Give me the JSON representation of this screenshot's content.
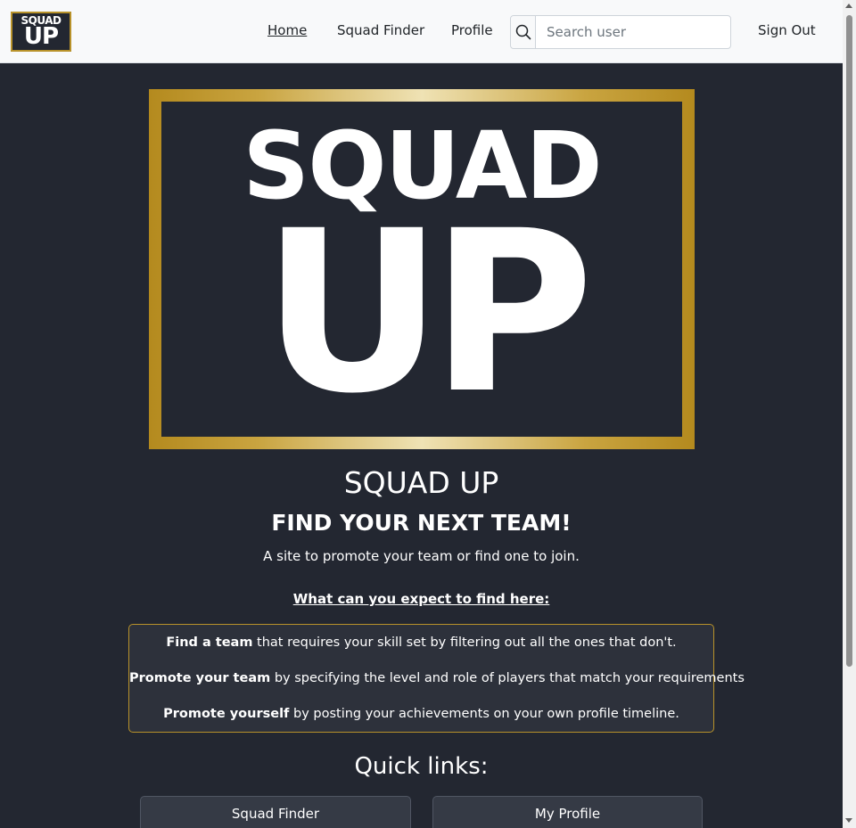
{
  "navbar": {
    "logo": {
      "line1": "SQUAD",
      "line2": "UP"
    },
    "links": [
      {
        "label": "Home",
        "active": true
      },
      {
        "label": "Squad Finder"
      },
      {
        "label": "Profile"
      }
    ],
    "search": {
      "placeholder": "Search user",
      "value": ""
    },
    "sign_out_label": "Sign Out"
  },
  "hero": {
    "line1": "SQUAD",
    "line2": "UP",
    "frame_color": "#b8922a"
  },
  "main": {
    "title": "SQUAD UP",
    "subtitle": "FIND YOUR NEXT TEAM!",
    "tagline": "A site to promote your team or find one to join.",
    "expect_heading": "What can you expect to find here:",
    "features": [
      {
        "bold": "Find a team",
        "text": " that requires your skill set by filtering out all the ones that don't."
      },
      {
        "bold": "Promote your team",
        "text": " by specifying the level and role of players that match your requirements"
      },
      {
        "bold": "Promote yourself",
        "text": " by posting your achievements on your own profile timeline."
      }
    ]
  },
  "quick_links": {
    "title": "Quick links:",
    "buttons": [
      {
        "label": "Squad Finder"
      },
      {
        "label": "My Profile"
      }
    ]
  },
  "colors": {
    "background": "#232731",
    "accent": "#b8922a",
    "navbar": "#f8f9fa"
  }
}
